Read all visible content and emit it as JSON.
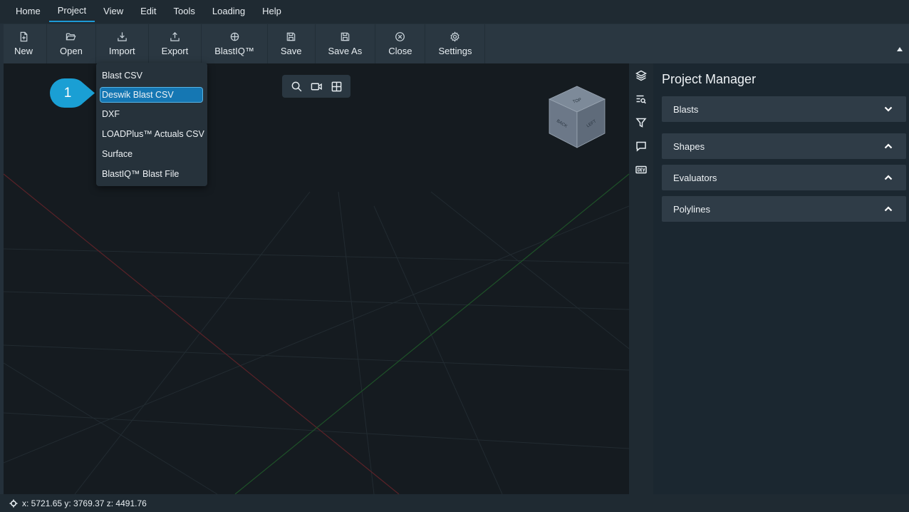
{
  "menu": [
    "Home",
    "Project",
    "View",
    "Edit",
    "Tools",
    "Loading",
    "Help"
  ],
  "ribbon": [
    {
      "label": "New",
      "icon": "new-file-icon"
    },
    {
      "label": "Open",
      "icon": "folder-open-icon"
    },
    {
      "label": "Import",
      "icon": "import-icon"
    },
    {
      "label": "Export",
      "icon": "export-icon"
    },
    {
      "label": "BlastIQ™",
      "icon": "blastiq-icon"
    },
    {
      "label": "Save",
      "icon": "save-icon"
    },
    {
      "label": "Save As",
      "icon": "save-as-icon"
    },
    {
      "label": "Close",
      "icon": "close-circle-icon"
    },
    {
      "label": "Settings",
      "icon": "gear-icon"
    }
  ],
  "import_menu": {
    "items": [
      "Blast CSV",
      "Deswik Blast CSV",
      "DXF",
      "LOADPlus™ Actuals CSV",
      "Surface",
      "BlastIQ™ Blast File"
    ],
    "selected": "Deswik Blast CSV"
  },
  "step_badge": "1",
  "nav_cube": {
    "top": "TOP",
    "back": "BACK",
    "left": "LEFT"
  },
  "project_manager": {
    "title": "Project Manager",
    "sections": [
      "Blasts",
      "Shapes",
      "Evaluators",
      "Polylines"
    ]
  },
  "status": {
    "coords": "x: 5721.65 y: 3769.37 z: 4491.76"
  },
  "colors": {
    "accent": "#1d9ad6",
    "selected": "#1577b3",
    "badge": "#1a9fd4"
  }
}
